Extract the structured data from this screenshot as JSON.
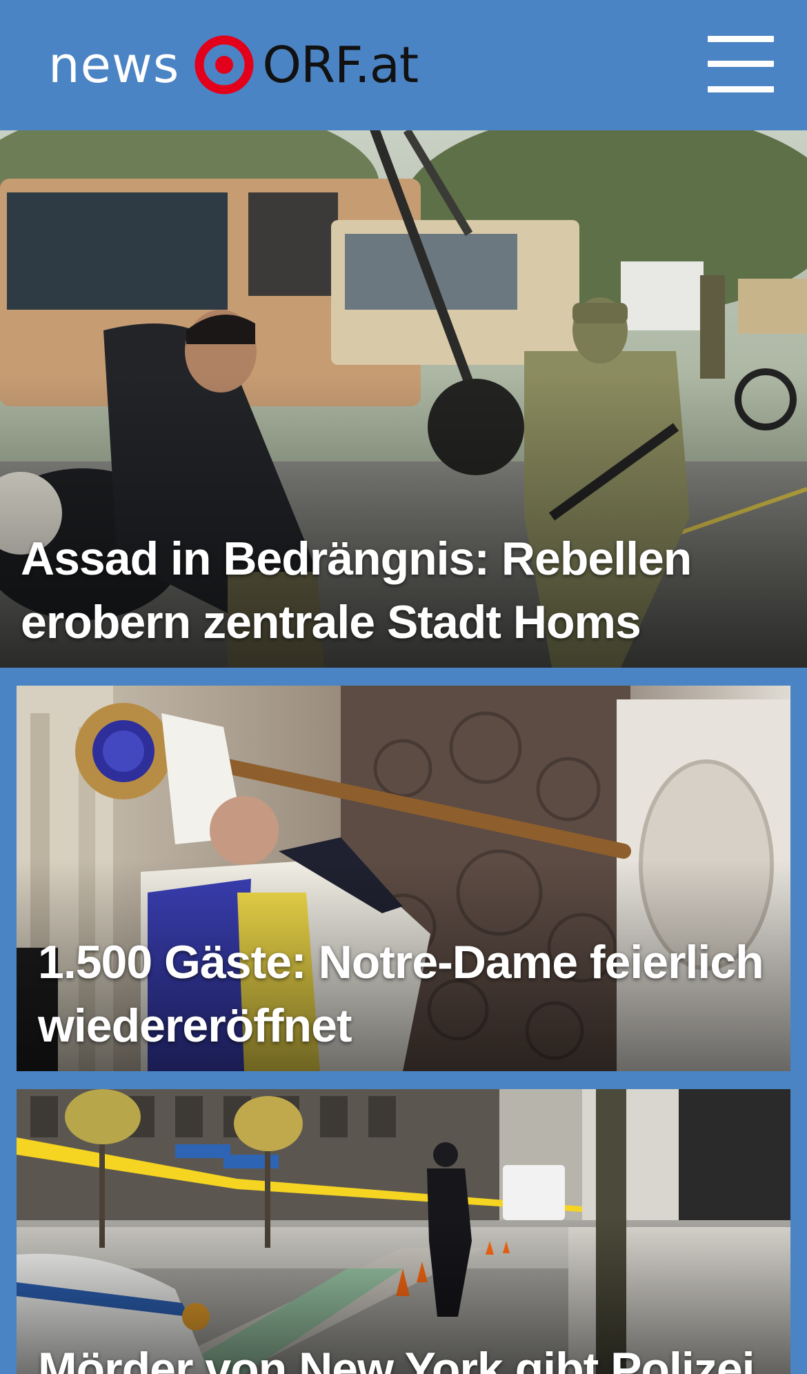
{
  "header": {
    "logo_news": "news",
    "logo_orf": "ORF.at",
    "brand_color": "#e3001b",
    "background_color": "#4b84c4",
    "menu_icon": "hamburger-menu-icon"
  },
  "stories": [
    {
      "headline": "Assad in Bedrängnis: Rebellen erobern zentrale Stadt Homs"
    },
    {
      "headline": "1.500 Gäste: Notre-Dame feierlich wiedereröffnet"
    },
    {
      "headline": "Mörder von New York gibt Polizei"
    }
  ]
}
